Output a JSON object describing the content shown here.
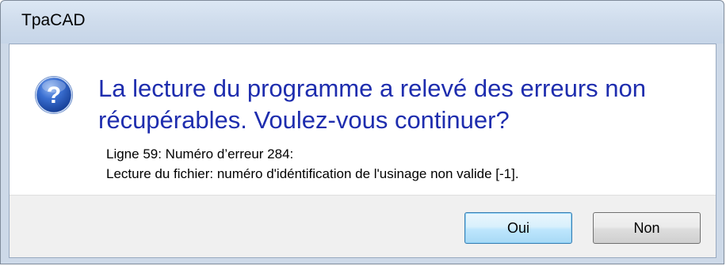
{
  "window": {
    "title": "TpaCAD"
  },
  "dialog": {
    "icon": "question-icon",
    "main_instruction": "La lecture du programme a relevé des erreurs non récupérables. Voulez-vous continuer?",
    "details": [
      "Ligne 59: Numéro d’erreur 284:",
      "Lecture du fichier: numéro d'idéntification de l'usinage non valide [-1]."
    ]
  },
  "buttons": {
    "yes_label": "Oui",
    "no_label": "Non"
  },
  "colors": {
    "instruction_text": "#1e2dae",
    "icon_blue": "#2b5fc4"
  }
}
